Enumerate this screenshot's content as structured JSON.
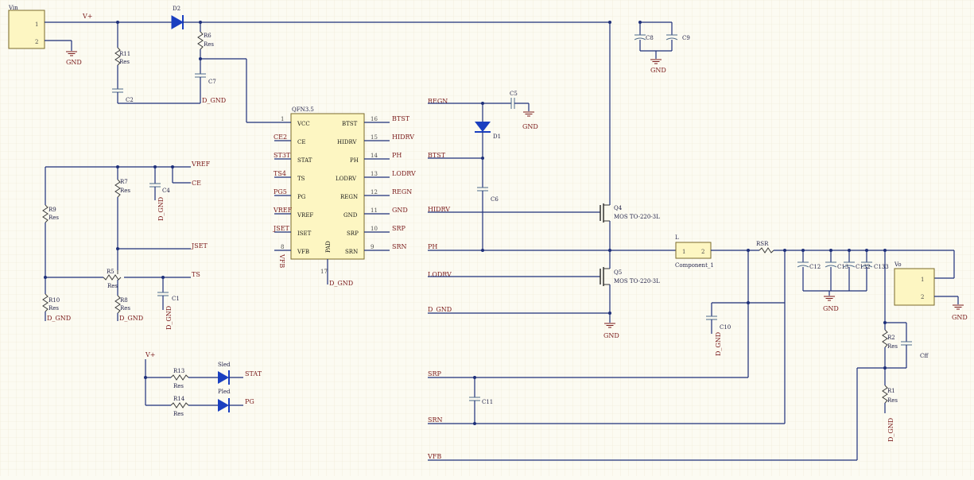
{
  "sheet": {
    "grid": true,
    "background": "#fcfbf2",
    "wire_color": "#1d2f7a",
    "net_label_color": "#7a1a1a"
  },
  "connectors": {
    "vin": {
      "name": "Vin",
      "pin1": "1",
      "pin2": "2"
    },
    "vo": {
      "name": "Vo",
      "pin1": "1",
      "pin2": "2"
    }
  },
  "ic": {
    "package": "QFN3.5",
    "left_pins": [
      {
        "num": "1",
        "name": "VCC",
        "net": ""
      },
      {
        "num": "",
        "name": "CE",
        "net": "CE2"
      },
      {
        "num": "",
        "name": "STAT",
        "net": "ST3T"
      },
      {
        "num": "",
        "name": "TS",
        "net": "TS4"
      },
      {
        "num": "",
        "name": "PG",
        "net": "PG5"
      },
      {
        "num": "",
        "name": "VREF",
        "net": "VREF"
      },
      {
        "num": "",
        "name": "ISET",
        "net": "JSET"
      },
      {
        "num": "8",
        "name": "VFB",
        "net": "VFB"
      }
    ],
    "right_pins": [
      {
        "num": "16",
        "name": "BTST",
        "net": "BTST"
      },
      {
        "num": "15",
        "name": "HIDRV",
        "net": "HIDRV"
      },
      {
        "num": "14",
        "name": "PH",
        "net": "PH"
      },
      {
        "num": "13",
        "name": "LODRV",
        "net": "LODRV"
      },
      {
        "num": "12",
        "name": "REGN",
        "net": "REGN"
      },
      {
        "num": "11",
        "name": "GND",
        "net": "GND"
      },
      {
        "num": "10",
        "name": "SRP",
        "net": "SRP"
      },
      {
        "num": "9",
        "name": "SRN",
        "net": "SRN"
      }
    ],
    "pad_label": "PAD",
    "pad_num": "17",
    "pad_net": "D_GND"
  },
  "nets": {
    "v_plus": "V+",
    "gnd": "GND",
    "d_gnd": "D_GND",
    "vref": "VREF",
    "ce": "CE",
    "jset": "JSET",
    "ts": "TS",
    "stat": "STAT",
    "pg": "PG",
    "regn": "REGN",
    "btst": "BTST",
    "hidrv": "HIDRV",
    "ph": "PH",
    "lodrv": "LODRV",
    "srp": "SRP",
    "srn": "SRN",
    "vfb": "VFB"
  },
  "components": {
    "d2": "D2",
    "d1": "D1",
    "r6": "R6",
    "r11": "R11",
    "r7": "R7",
    "r9": "R9",
    "r5": "R5",
    "r10": "R10",
    "r8": "R8",
    "r13": "R13",
    "r14": "R14",
    "r2": "R2",
    "r1": "R1",
    "rsr": "RSR",
    "res": "Res",
    "c2": "C2",
    "c7": "C7",
    "c4": "C4",
    "c1": "C1",
    "c5": "C5",
    "c6": "C6",
    "c8": "C8",
    "c9": "C9",
    "c10": "C10",
    "c11": "C11",
    "c12": "C12",
    "c13": "C13",
    "c132": "C132",
    "c133": "C133",
    "cff": "Cff",
    "q4": "Q4",
    "q5": "Q5",
    "mos_type": "MOS TO-220-3L",
    "inductor": "L",
    "inductor_comp": "Component_1",
    "sled": "Sled",
    "pled": "Pled"
  }
}
